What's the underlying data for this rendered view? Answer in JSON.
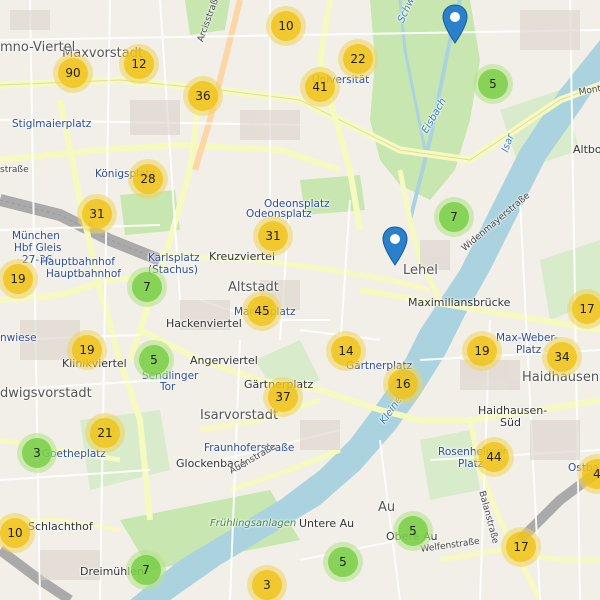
{
  "map": {
    "colors": {
      "land": "#f2efe9",
      "park": "#c8e6b0",
      "water": "#aad3df",
      "road": "#ffffff",
      "major": "#f7fabf",
      "rail": "#999999",
      "building": "#d9d0c9",
      "pin": "#2a81cb"
    },
    "labels": [
      {
        "id": "maxvorstadt",
        "text": "Maxvorstadt",
        "cls": "big"
      },
      {
        "id": "mno-viertel",
        "text": "mno-Viertel",
        "cls": "big"
      },
      {
        "id": "stiglmaierplatz",
        "text": "Stiglmaierplatz",
        "cls": "blue"
      },
      {
        "id": "universitat",
        "text": "Universität",
        "cls": "blue"
      },
      {
        "id": "konigsplatz",
        "text": "Königsplatz",
        "cls": "blue"
      },
      {
        "id": "odeonsplatz1",
        "text": "Odeonsplatz",
        "cls": "blue"
      },
      {
        "id": "odeonsplatz2",
        "text": "Odeonsplatz",
        "cls": "blue"
      },
      {
        "id": "munchen-hbf",
        "text": "München",
        "cls": "blue"
      },
      {
        "id": "hbf-gleis",
        "text": "Hbf Gleis",
        "cls": "blue"
      },
      {
        "id": "hbf-2736",
        "text": "27-36",
        "cls": "blue"
      },
      {
        "id": "hauptbahnhof1",
        "text": "Hauptbahnhof",
        "cls": "blue"
      },
      {
        "id": "hauptbahnhof2",
        "text": "Hauptbahnhof",
        "cls": "blue"
      },
      {
        "id": "karlsplatz",
        "text": "Karlsplatz",
        "cls": "blue"
      },
      {
        "id": "stachus",
        "text": "(Stachus)",
        "cls": "blue"
      },
      {
        "id": "kreuzviertel",
        "text": "Kreuzviertel",
        "cls": ""
      },
      {
        "id": "altstadt",
        "text": "Altstadt",
        "cls": "big"
      },
      {
        "id": "hackenviertel",
        "text": "Hackenviertel",
        "cls": ""
      },
      {
        "id": "marienplatz",
        "text": "Marienplatz",
        "cls": "blue"
      },
      {
        "id": "angerviertel",
        "text": "Angerviertel",
        "cls": ""
      },
      {
        "id": "klinikviertel",
        "text": "Klinikviertel",
        "cls": ""
      },
      {
        "id": "sendlinger",
        "text": "Sendlinger",
        "cls": "blue"
      },
      {
        "id": "tor",
        "text": "Tor",
        "cls": "blue"
      },
      {
        "id": "ludwigsvorstadt",
        "text": "dwigsvorstadt",
        "cls": "big"
      },
      {
        "id": "wiese",
        "text": "nwiese",
        "cls": "blue"
      },
      {
        "id": "gartnerplatz",
        "text": "Gärtnerplatz",
        "cls": ""
      },
      {
        "id": "isarvorstadt",
        "text": "Isarvorstadt",
        "cls": "big"
      },
      {
        "id": "fraunhofer",
        "text": "Fraunhoferstraße",
        "cls": "blue"
      },
      {
        "id": "glockenbach",
        "text": "Glockenbach",
        "cls": ""
      },
      {
        "id": "goetheplatz",
        "text": "Goetheplatz",
        "cls": "blue"
      },
      {
        "id": "schlachthof",
        "text": "Schlachthof",
        "cls": ""
      },
      {
        "id": "dreimuhlen",
        "text": "Dreimühlen",
        "cls": ""
      },
      {
        "id": "fruhlingsanlagen",
        "text": "Frühlingsanlagen",
        "cls": "green"
      },
      {
        "id": "untere-au",
        "text": "Untere Au",
        "cls": ""
      },
      {
        "id": "au",
        "text": "Au",
        "cls": "big"
      },
      {
        "id": "obere-au",
        "text": "Obere Au",
        "cls": ""
      },
      {
        "id": "lehel",
        "text": "Lehel",
        "cls": "big"
      },
      {
        "id": "maxbrucke",
        "text": "Maximiliansbrücke",
        "cls": ""
      },
      {
        "id": "widenmayer",
        "text": "Widenmayerstraße",
        "cls": "street"
      },
      {
        "id": "max-weber",
        "text": "Max-Weber-",
        "cls": "blue"
      },
      {
        "id": "max-weber2",
        "text": "Platz",
        "cls": "blue"
      },
      {
        "id": "haidhausen",
        "text": "Haidhausen",
        "cls": "big"
      },
      {
        "id": "haidhausen-sud",
        "text": "Haidhausen-",
        "cls": ""
      },
      {
        "id": "haidhausen-sud2",
        "text": "Süd",
        "cls": ""
      },
      {
        "id": "rosenheimer",
        "text": "Rosenheimer",
        "cls": "blue"
      },
      {
        "id": "rosenheimer2",
        "text": "Platz",
        "cls": "blue"
      },
      {
        "id": "altbogenhausen",
        "text": "Altbo",
        "cls": ""
      },
      {
        "id": "isar",
        "text": "Isar",
        "cls": "water"
      },
      {
        "id": "eisbach",
        "text": "Eisbach",
        "cls": "water"
      },
      {
        "id": "schwabinger",
        "text": "Schwabinger",
        "cls": "water"
      },
      {
        "id": "kleine-isar",
        "text": "Kleine",
        "cls": "water"
      },
      {
        "id": "arcisstrasse",
        "text": "Arcisstraße",
        "cls": "street"
      },
      {
        "id": "auenstrasse",
        "text": "Auenstraße",
        "cls": "street"
      },
      {
        "id": "welfenstrasse",
        "text": "Welfenstraße",
        "cls": "street"
      },
      {
        "id": "balanstrasse",
        "text": "Balanstraße",
        "cls": "street"
      },
      {
        "id": "strasse-left",
        "text": "straße",
        "cls": "street"
      },
      {
        "id": "monte",
        "text": "Monte",
        "cls": "street"
      },
      {
        "id": "ostbahnhof",
        "text": "Ostbahnhof",
        "cls": "blue"
      },
      {
        "id": "gartner2",
        "text": "Gärtnerplatz",
        "cls": "blue"
      }
    ],
    "clusters": [
      {
        "id": "c1",
        "count": "10",
        "color": "yellow"
      },
      {
        "id": "c2",
        "count": "90",
        "color": "yellow"
      },
      {
        "id": "c3",
        "count": "12",
        "color": "yellow"
      },
      {
        "id": "c4",
        "count": "22",
        "color": "yellow"
      },
      {
        "id": "c5",
        "count": "36",
        "color": "yellow"
      },
      {
        "id": "c6",
        "count": "41",
        "color": "yellow"
      },
      {
        "id": "c7",
        "count": "5",
        "color": "green"
      },
      {
        "id": "c8",
        "count": "28",
        "color": "yellow"
      },
      {
        "id": "c9",
        "count": "31",
        "color": "yellow"
      },
      {
        "id": "c10",
        "count": "7",
        "color": "green"
      },
      {
        "id": "c11",
        "count": "31",
        "color": "yellow"
      },
      {
        "id": "c12",
        "count": "19",
        "color": "yellow"
      },
      {
        "id": "c13",
        "count": "7",
        "color": "green"
      },
      {
        "id": "c14",
        "count": "45",
        "color": "yellow"
      },
      {
        "id": "c15",
        "count": "17",
        "color": "yellow"
      },
      {
        "id": "c16",
        "count": "19",
        "color": "yellow"
      },
      {
        "id": "c17",
        "count": "5",
        "color": "green"
      },
      {
        "id": "c18",
        "count": "14",
        "color": "yellow"
      },
      {
        "id": "c19",
        "count": "19",
        "color": "yellow"
      },
      {
        "id": "c20",
        "count": "34",
        "color": "yellow"
      },
      {
        "id": "c21",
        "count": "16",
        "color": "yellow"
      },
      {
        "id": "c22",
        "count": "37",
        "color": "yellow"
      },
      {
        "id": "c23",
        "count": "21",
        "color": "yellow"
      },
      {
        "id": "c24",
        "count": "3",
        "color": "green"
      },
      {
        "id": "c25",
        "count": "44",
        "color": "yellow"
      },
      {
        "id": "c26",
        "count": "4",
        "color": "yellow"
      },
      {
        "id": "c27",
        "count": "10",
        "color": "yellow"
      },
      {
        "id": "c28",
        "count": "5",
        "color": "green"
      },
      {
        "id": "c29",
        "count": "17",
        "color": "yellow"
      },
      {
        "id": "c30",
        "count": "7",
        "color": "green"
      },
      {
        "id": "c31",
        "count": "5",
        "color": "green"
      },
      {
        "id": "c32",
        "count": "3",
        "color": "yellow"
      }
    ],
    "pins": [
      {
        "id": "pin-north",
        "icon": "map-marker-icon"
      },
      {
        "id": "pin-lehel",
        "icon": "map-marker-icon"
      }
    ]
  }
}
